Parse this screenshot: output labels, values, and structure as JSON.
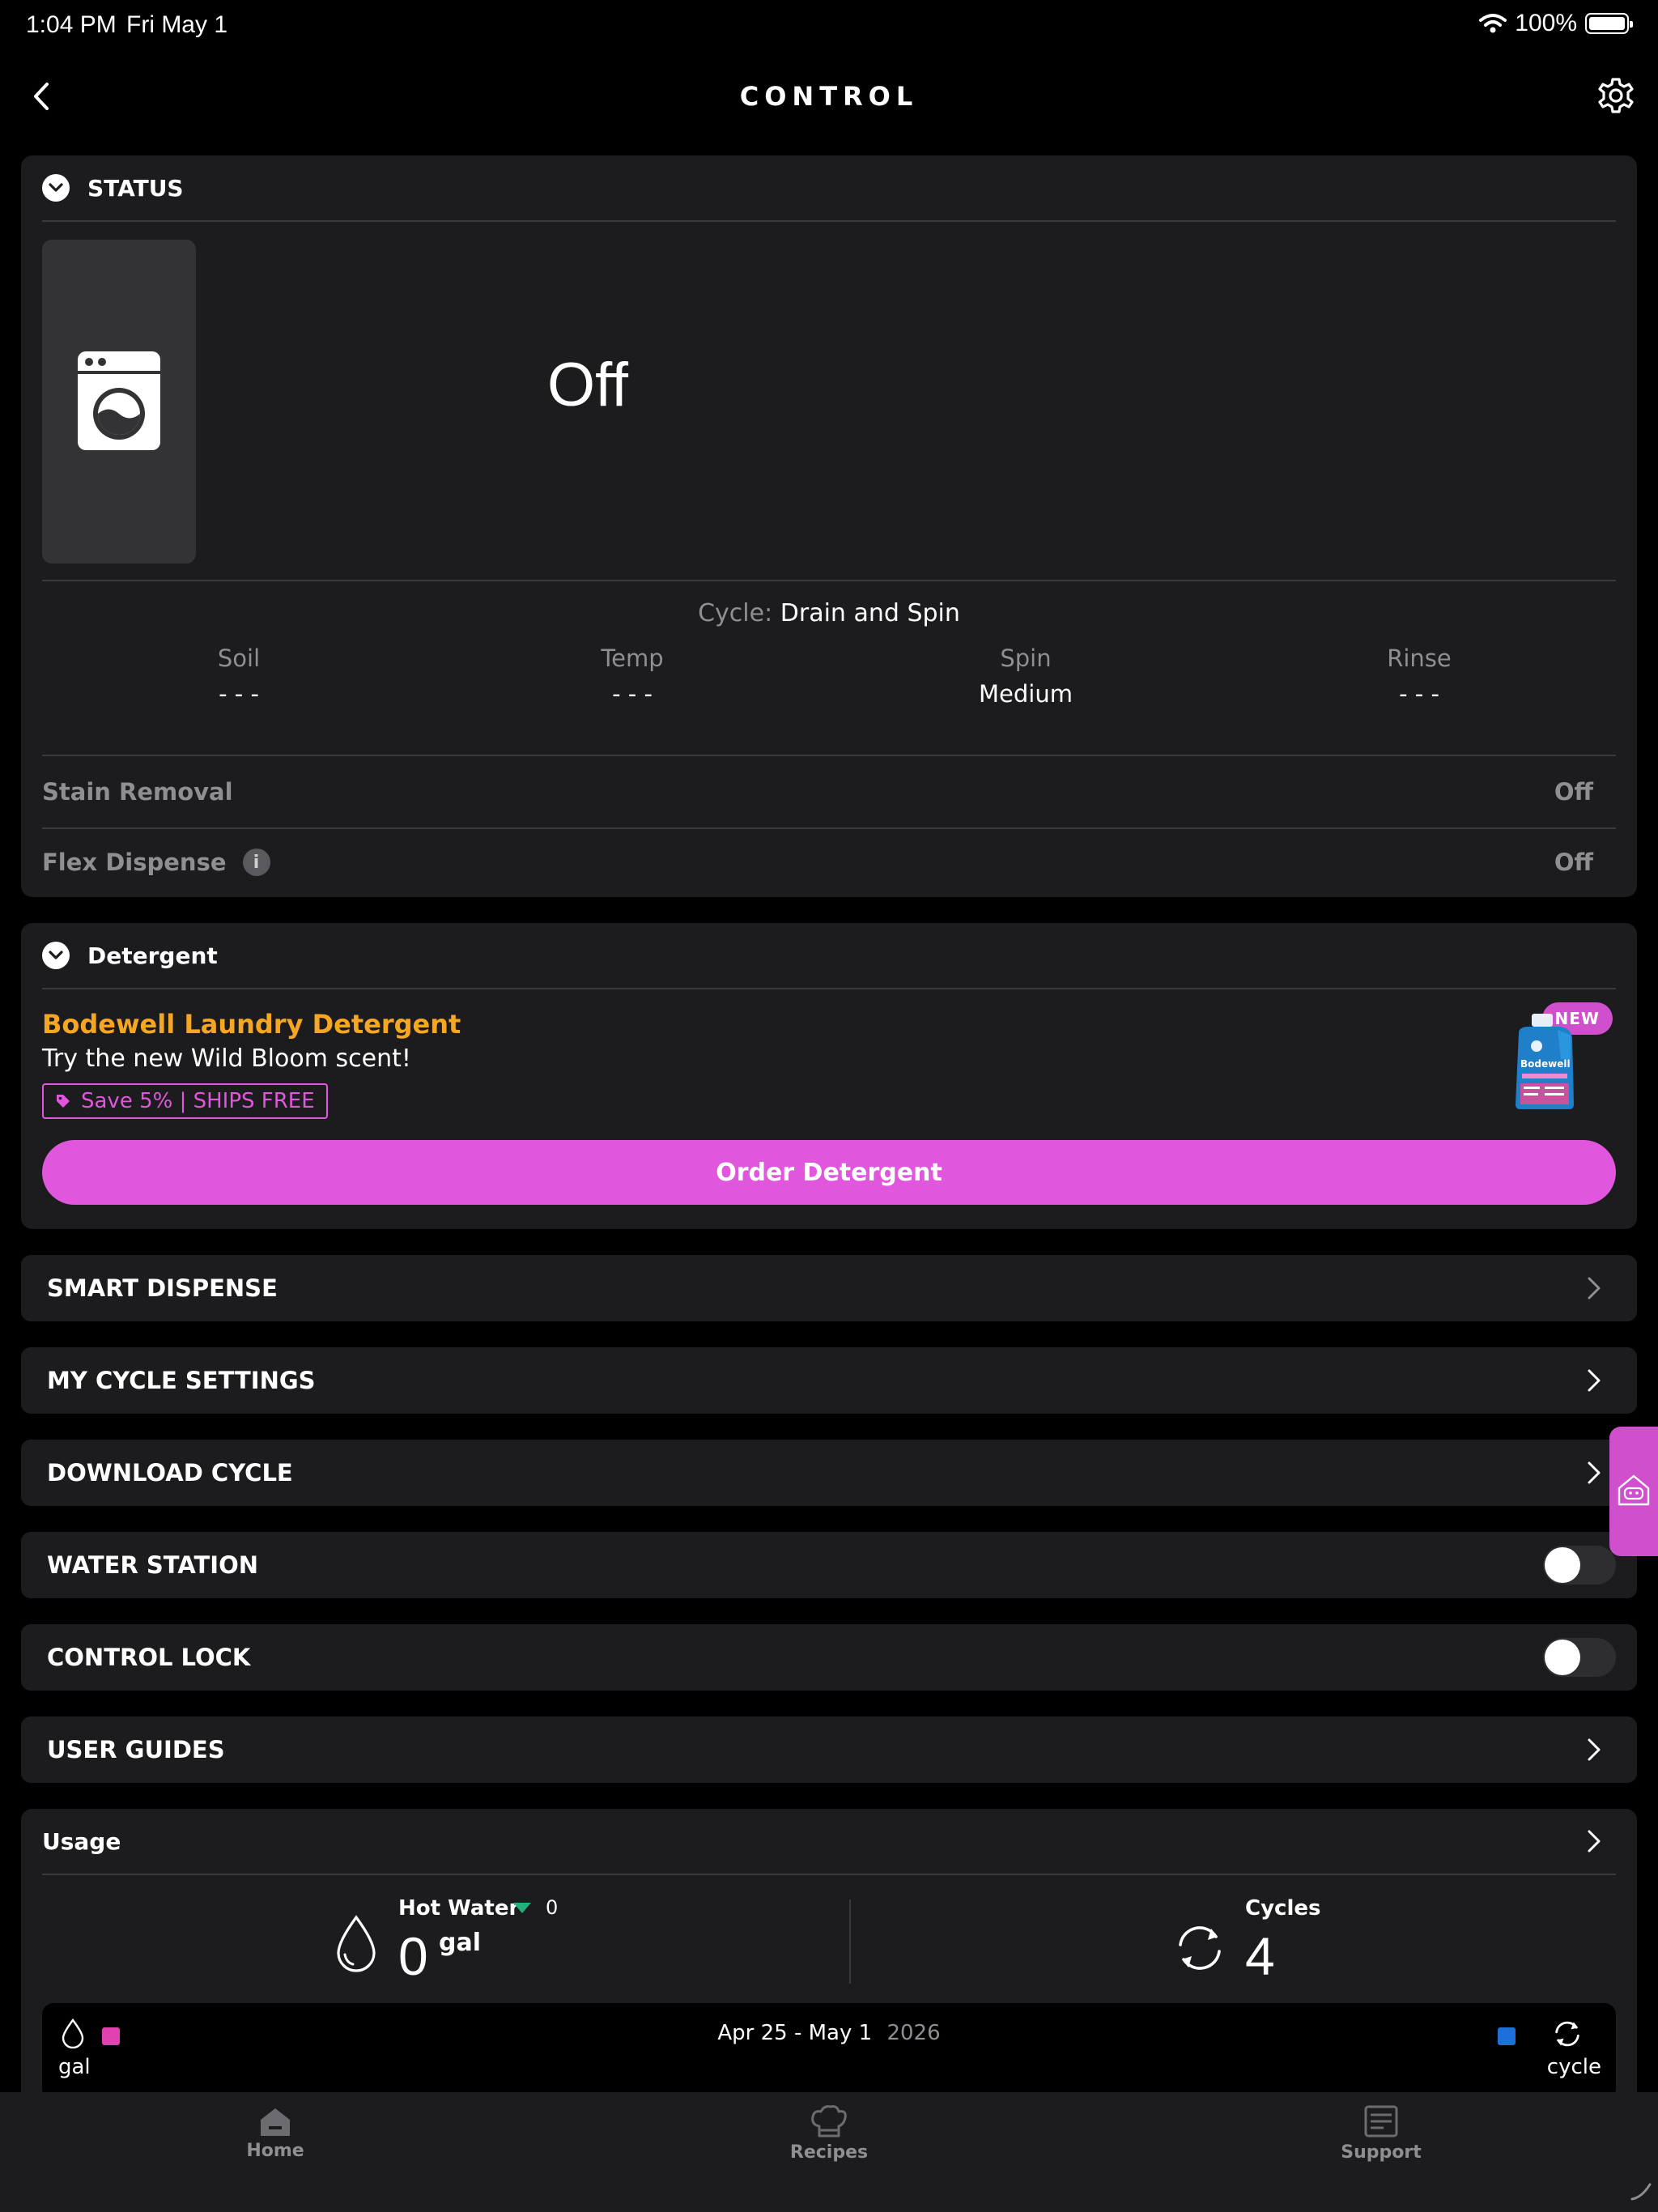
{
  "statusbar": {
    "time": "1:04 PM",
    "date": "Fri May 1",
    "battery": "100%"
  },
  "header": {
    "title": "CONTROL"
  },
  "status": {
    "section_label": "STATUS",
    "state": "Off",
    "cycle_prefix": "Cycle:",
    "cycle_value": "Drain and Spin",
    "metrics": [
      {
        "label": "Soil",
        "value": "- - -"
      },
      {
        "label": "Temp",
        "value": "- - -"
      },
      {
        "label": "Spin",
        "value": "Medium"
      },
      {
        "label": "Rinse",
        "value": "- - -"
      }
    ],
    "stain_removal": {
      "label": "Stain Removal",
      "value": "Off"
    },
    "flex_dispense": {
      "label": "Flex Dispense",
      "info": "i",
      "value": "Off"
    }
  },
  "detergent": {
    "section_label": "Detergent",
    "brand": "Bodewell Laundry Detergent",
    "subtitle": "Try the new Wild Bloom scent!",
    "tag": "Save 5% | SHIPS FREE",
    "badge": "NEW",
    "bottle_label": "Bodewell",
    "order_button": "Order Detergent"
  },
  "nav_rows": {
    "smart_dispense": "SMART DISPENSE",
    "my_cycle_settings": "MY CYCLE SETTINGS",
    "download_cycle": "DOWNLOAD CYCLE",
    "water_station": "WATER STATION",
    "control_lock": "CONTROL LOCK",
    "user_guides": "USER GUIDES"
  },
  "toggles": {
    "water_station": false,
    "control_lock": false
  },
  "usage": {
    "title": "Usage",
    "hot_water": {
      "label": "Hot Water",
      "change": "0",
      "value": "0",
      "unit": "gal"
    },
    "cycles": {
      "label": "Cycles",
      "value": "4"
    },
    "chart": {
      "left_unit": "gal",
      "right_unit": "cycle",
      "range": "Apr 25 - May 1",
      "year": "2026"
    }
  },
  "tabbar": {
    "home": "Home",
    "recipes": "Recipes",
    "support": "Support"
  },
  "colors": {
    "accent": "#e056dd",
    "brand_gold": "#f5a623",
    "card": "#1c1c1e",
    "cycles_series": "#1e6fd9"
  }
}
